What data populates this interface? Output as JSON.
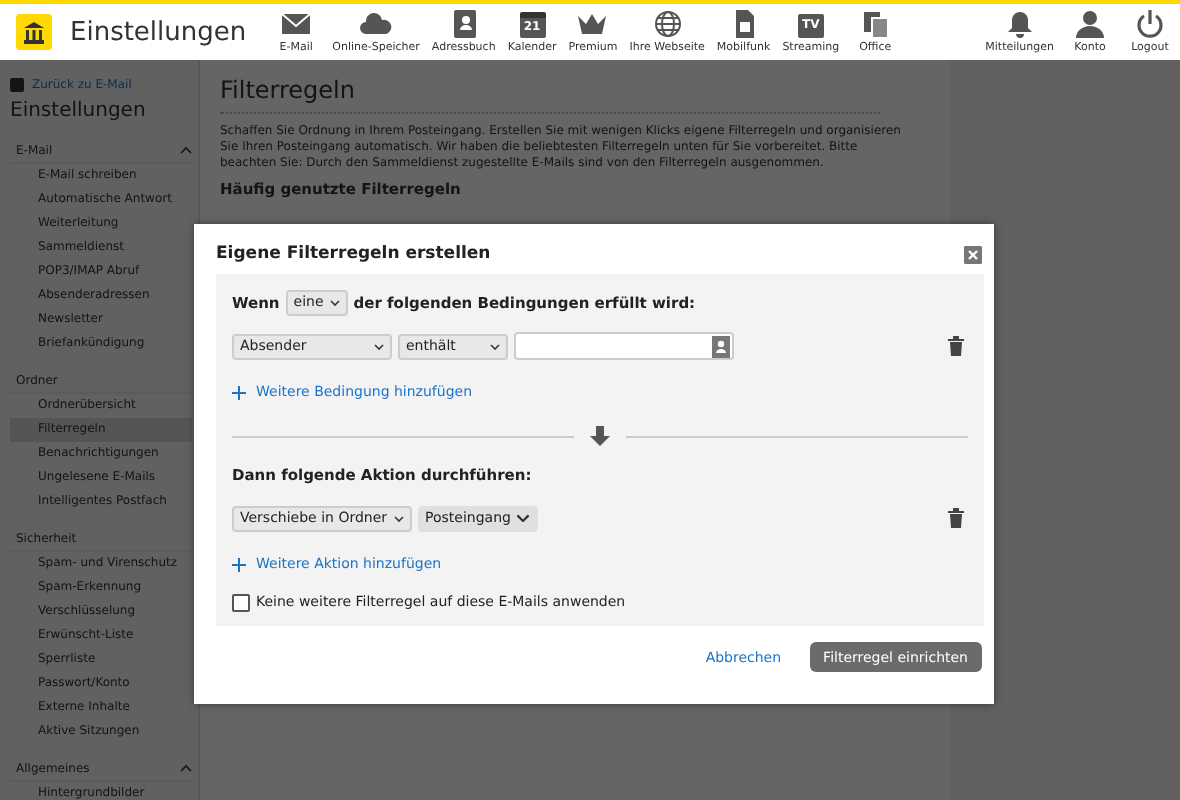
{
  "header": {
    "title": "Einstellungen",
    "nav": [
      {
        "label": "E-Mail",
        "kind": "mail"
      },
      {
        "label": "Online-Speicher",
        "kind": "cloud"
      },
      {
        "label": "Adressbuch",
        "kind": "contacts"
      },
      {
        "label": "Kalender",
        "kind": "calendar",
        "glyph": "21"
      },
      {
        "label": "Premium",
        "kind": "crown"
      },
      {
        "label": "Ihre Webseite",
        "kind": "globe"
      },
      {
        "label": "Mobilfunk",
        "kind": "sim"
      },
      {
        "label": "Streaming",
        "kind": "tv",
        "glyph": "TV"
      },
      {
        "label": "Office",
        "kind": "office"
      }
    ],
    "nav_right": [
      {
        "label": "Mitteilungen",
        "kind": "bell"
      },
      {
        "label": "Konto",
        "kind": "person"
      },
      {
        "label": "Logout",
        "kind": "power"
      }
    ]
  },
  "sidebar": {
    "back_link": "Zurück zu E-Mail",
    "title": "Einstellungen",
    "groups": [
      {
        "label": "E-Mail",
        "collapsible": true,
        "items": [
          {
            "label": "E-Mail schreiben",
            "selected": false
          },
          {
            "label": "Automatische Antwort",
            "selected": false
          },
          {
            "label": "Weiterleitung",
            "selected": false
          },
          {
            "label": "Sammeldienst",
            "selected": false
          },
          {
            "label": "POP3/IMAP Abruf",
            "selected": false
          },
          {
            "label": "Absenderadressen",
            "selected": false
          },
          {
            "label": "Newsletter",
            "selected": false
          },
          {
            "label": "Briefankündigung",
            "selected": false
          }
        ]
      },
      {
        "label": "Ordner",
        "collapsible": false,
        "items": [
          {
            "label": "Ordnerübersicht",
            "selected": false
          },
          {
            "label": "Filterregeln",
            "selected": true
          },
          {
            "label": "Benachrichtigungen",
            "selected": false
          },
          {
            "label": "Ungelesene E-Mails",
            "selected": false
          },
          {
            "label": "Intelligentes Postfach",
            "selected": false
          }
        ]
      },
      {
        "label": "Sicherheit",
        "collapsible": false,
        "items": [
          {
            "label": "Spam- und Virenschutz",
            "selected": false
          },
          {
            "label": "Spam-Erkennung",
            "selected": false
          },
          {
            "label": "Verschlüsselung",
            "selected": false
          },
          {
            "label": "Erwünscht-Liste",
            "selected": false
          },
          {
            "label": "Sperrliste",
            "selected": false
          },
          {
            "label": "Passwort/Konto",
            "selected": false
          },
          {
            "label": "Externe Inhalte",
            "selected": false
          },
          {
            "label": "Aktive Sitzungen",
            "selected": false
          }
        ]
      },
      {
        "label": "Allgemeines",
        "collapsible": true,
        "items": [
          {
            "label": "Hintergrundbilder",
            "selected": false
          }
        ]
      }
    ]
  },
  "main": {
    "title": "Filterregeln",
    "intro": "Schaffen Sie Ordnung in Ihrem Posteingang. Erstellen Sie mit wenigen Klicks eigene Filterregeln und organisieren Sie Ihren Posteingang automatisch. Wir haben die beliebtesten Filterregeln unten für Sie vorbereitet. Bitte beachten Sie: Durch den Sammeldienst zugestellte E-Mails sind von den Filterregeln ausgenommen.",
    "subheading": "Häufig genutzte Filterregeln"
  },
  "dialog": {
    "title": "Eigene Filterregeln erstellen",
    "condition_prefix": "Wenn",
    "match": "eine",
    "condition_suffix": "der folgenden Bedingungen erfüllt wird:",
    "conditions": [
      {
        "field": "Absender",
        "operator": "enthält"
      }
    ],
    "add_condition": "Weitere Bedingung hinzufügen",
    "action_heading": "Dann folgende Aktion durchführen:",
    "actions": [
      {
        "action": "Verschiebe in Ordner",
        "folder": "Posteingang"
      }
    ],
    "add_action": "Weitere Aktion hinzufügen",
    "stop_rule": {
      "label": "Keine weitere Filterregel auf diese E-Mails anwenden",
      "checked": false
    },
    "cancel": "Abbrechen",
    "submit": "Filterregel einrichten"
  }
}
